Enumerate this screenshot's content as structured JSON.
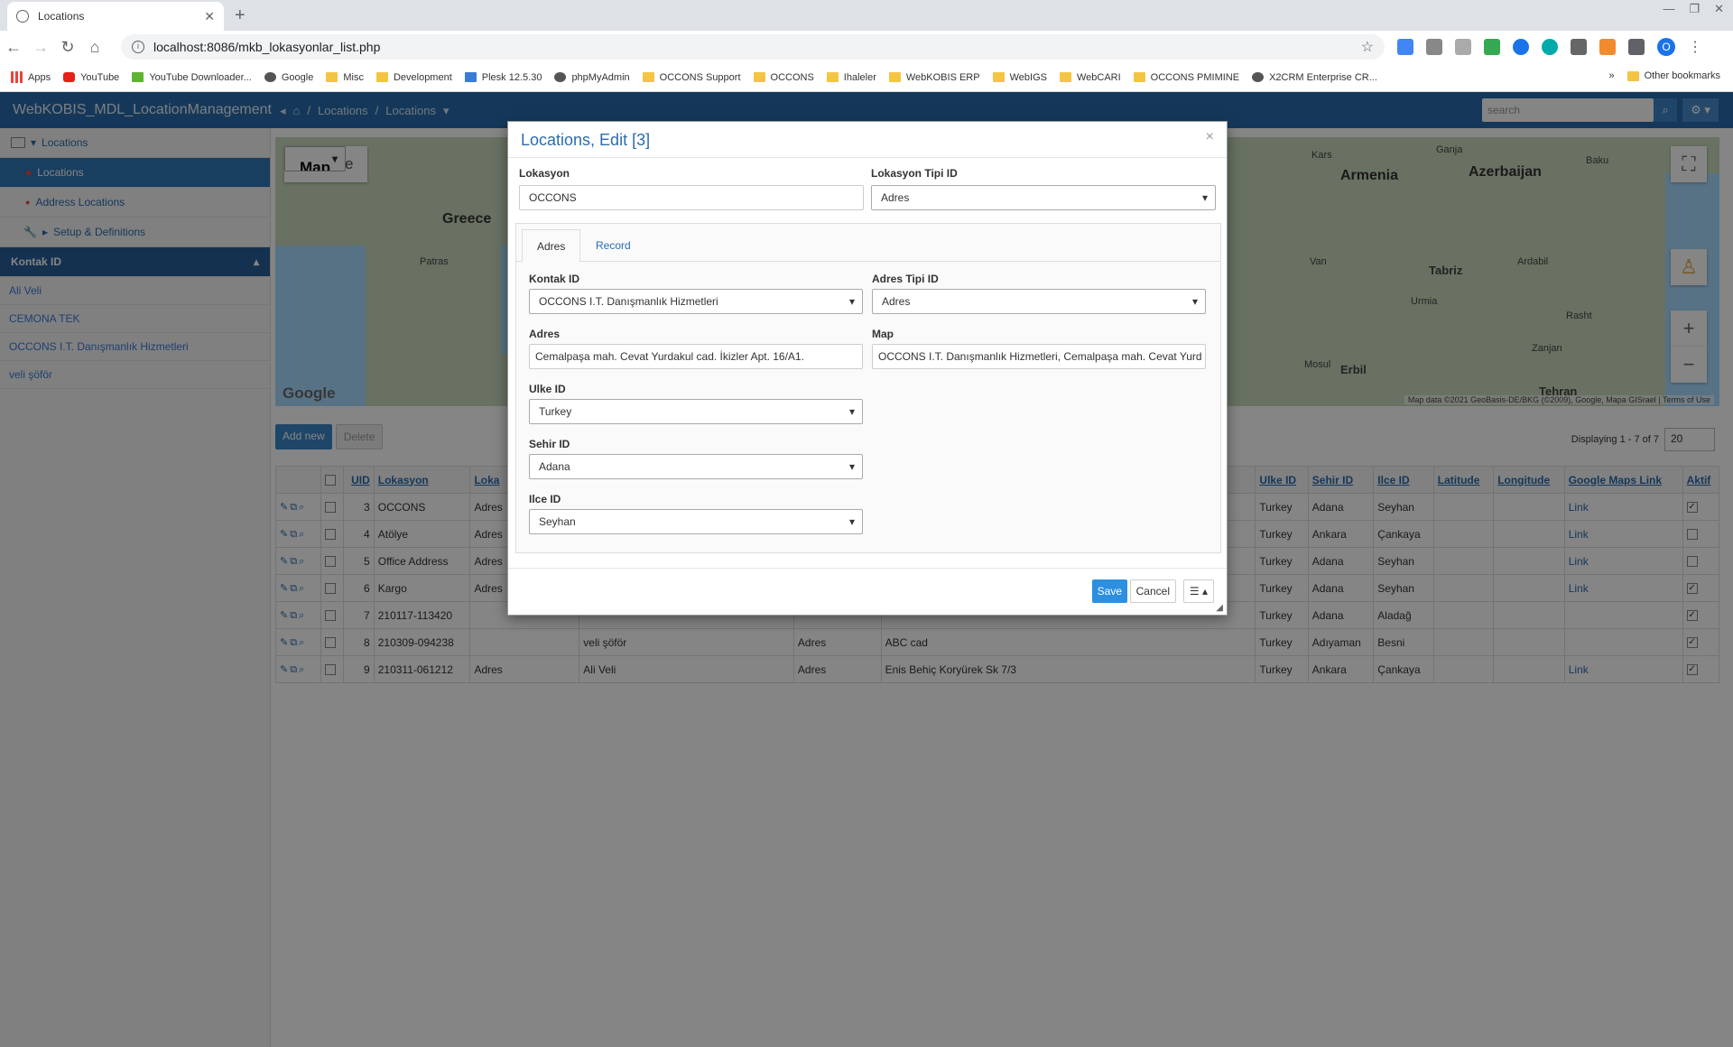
{
  "browser": {
    "tab_title": "Locations",
    "url": "localhost:8086/mkb_lokasyonlar_list.php",
    "bookmarks": [
      "Apps",
      "YouTube",
      "YouTube Downloader...",
      "Google",
      "Misc",
      "Development",
      "Plesk 12.5.30",
      "phpMyAdmin",
      "OCCONS Support",
      "OCCONS",
      "Ihaleler",
      "WebKOBIS ERP",
      "WebIGS",
      "WebCARI",
      "OCCONS PMIMINE",
      "X2CRM Enterprise CR..."
    ],
    "other_bookmarks": "Other bookmarks",
    "profile_initial": "O"
  },
  "app": {
    "brand": "WebKOBIS_MDL_LocationManagement",
    "breadcrumb": [
      "Locations",
      "Locations"
    ],
    "search_placeholder": "search"
  },
  "sidebar": {
    "tree": [
      {
        "label": "Locations"
      },
      {
        "label": "Locations"
      },
      {
        "label": "Address Locations"
      },
      {
        "label": "Setup & Definitions"
      }
    ],
    "filter_header": "Kontak ID",
    "filter_items": [
      "Ali Veli",
      "CEMONA TEK",
      "OCCONS I.T. Danışmanlık Hizmetleri",
      "veli şöför"
    ]
  },
  "map": {
    "type_map": "Map",
    "type_satellite": "Satellite",
    "labels": [
      "Greece",
      "Armenia",
      "Azerbaijan",
      "Baku",
      "Tabriz",
      "Erbil",
      "Tehran",
      "Urmia",
      "Mosul",
      "Rasht",
      "Zanjan",
      "Ardabil",
      "Van",
      "Patras",
      "Kars",
      "Ganja"
    ],
    "google": "Google",
    "attribution": "Map data ©2021 GeoBasis-DE/BKG (©2009), Google, Mapa GISrael | Terms of Use"
  },
  "list": {
    "add_new": "Add new",
    "delete": "Delete",
    "paging_text": "Displaying 1 - 7 of 7",
    "page_size": "20",
    "columns": [
      "UID",
      "Lokasyon",
      "Loka",
      "Ulke ID",
      "Sehir ID",
      "Ilce ID",
      "Latitude",
      "Longitude",
      "Google Maps Link",
      "Aktif"
    ],
    "rows": [
      {
        "uid": "3",
        "lokasyon": "OCCONS",
        "loka": "Adres",
        "kontak": "",
        "tip": "",
        "adres": "",
        "ulke": "Turkey",
        "sehir": "Adana",
        "ilce": "Seyhan",
        "link": "Link",
        "aktif": true
      },
      {
        "uid": "4",
        "lokasyon": "Atölye",
        "loka": "Adres",
        "kontak": "",
        "tip": "",
        "adres": "",
        "ulke": "Turkey",
        "sehir": "Ankara",
        "ilce": "Çankaya",
        "link": "Link",
        "aktif": false
      },
      {
        "uid": "5",
        "lokasyon": "Office Address",
        "loka": "Adres",
        "kontak": "",
        "tip": "",
        "adres": "",
        "ulke": "Turkey",
        "sehir": "Adana",
        "ilce": "Seyhan",
        "link": "Link",
        "aktif": false
      },
      {
        "uid": "6",
        "lokasyon": "Kargo",
        "loka": "Adres",
        "kontak": "",
        "tip": "",
        "adres": "",
        "ulke": "Turkey",
        "sehir": "Adana",
        "ilce": "Seyhan",
        "link": "Link",
        "aktif": true
      },
      {
        "uid": "7",
        "lokasyon": "210117-113420",
        "loka": "",
        "kontak": "",
        "tip": "",
        "adres": "",
        "ulke": "Turkey",
        "sehir": "Adana",
        "ilce": "Aladağ",
        "link": "",
        "aktif": true
      },
      {
        "uid": "8",
        "lokasyon": "210309-094238",
        "loka": "",
        "kontak": "veli şöför",
        "tip": "Adres",
        "adres": "ABC cad",
        "ulke": "Turkey",
        "sehir": "Adıyaman",
        "ilce": "Besni",
        "link": "",
        "aktif": true
      },
      {
        "uid": "9",
        "lokasyon": "210311-061212",
        "loka": "Adres",
        "kontak": "Ali Veli",
        "tip": "Adres",
        "adres": "Enis Behiç Koryürek Sk 7/3",
        "ulke": "Turkey",
        "sehir": "Ankara",
        "ilce": "Çankaya",
        "link": "Link",
        "aktif": true
      }
    ]
  },
  "modal": {
    "title": "Locations, Edit [3]",
    "close": "×",
    "lokasyon_label": "Lokasyon",
    "lokasyon_value": "OCCONS",
    "tipi_label": "Lokasyon Tipi ID",
    "tipi_value": "Adres",
    "tab_adres": "Adres",
    "tab_record": "Record",
    "kontak_label": "Kontak ID",
    "kontak_value": "OCCONS I.T. Danışmanlık Hizmetleri",
    "adres_tipi_label": "Adres Tipi ID",
    "adres_tipi_value": "Adres",
    "adres_label": "Adres",
    "adres_value": "Cemalpaşa mah. Cevat Yurdakul cad. İkizler Apt. 16/A1.",
    "map_label": "Map",
    "map_value": "OCCONS I.T. Danışmanlık Hizmetleri, Cemalpaşa mah. Cevat Yurd",
    "ulke_label": "Ulke ID",
    "ulke_value": "Turkey",
    "sehir_label": "Sehir ID",
    "sehir_value": "Adana",
    "ilce_label": "Ilce ID",
    "ilce_value": "Seyhan",
    "save": "Save",
    "cancel": "Cancel",
    "menu": "☰ ▴"
  }
}
